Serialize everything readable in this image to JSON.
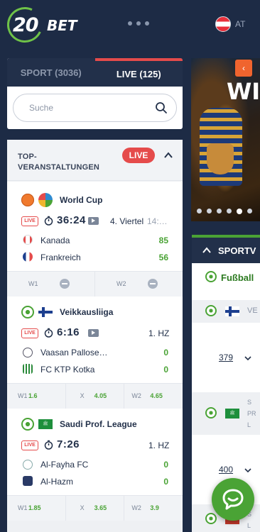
{
  "header": {
    "logo_number": "20",
    "logo_word": "BET",
    "language": "AT"
  },
  "tabs": {
    "sport": "SPORT (3036)",
    "live": "LIVE (125)"
  },
  "search": {
    "placeholder": "Suche"
  },
  "top_events": {
    "title_line1": "TOP-",
    "title_line2": "VERANSTALTUNGEN",
    "live_badge": "LIVE"
  },
  "events": [
    {
      "league": "World Cup",
      "live_tag": "LIVE",
      "time": "36:24",
      "period": "4. Viertel",
      "period_extra": "14:…",
      "team1": "Kanada",
      "team2": "Frankreich",
      "score1": "85",
      "score2": "56",
      "odds": [
        {
          "label": "W1",
          "value": ""
        },
        {
          "label": "W2",
          "value": ""
        }
      ]
    },
    {
      "league": "Veikkausliiga",
      "live_tag": "LIVE",
      "time": "6:16",
      "period": "1. HZ",
      "team1": "Vaasan Pallose…",
      "team2": "FC KTP Kotka",
      "score1": "0",
      "score2": "0",
      "odds": [
        {
          "label": "W1",
          "value": "1.6"
        },
        {
          "label": "X",
          "value": "4.05"
        },
        {
          "label": "W2",
          "value": "4.65"
        }
      ]
    },
    {
      "league": "Saudi Prof. League",
      "live_tag": "LIVE",
      "time": "7:26",
      "period": "1. HZ",
      "team1": "Al-Fayha FC",
      "team2": "Al-Hazm",
      "score1": "0",
      "score2": "0",
      "odds": [
        {
          "label": "W1",
          "value": "1.85"
        },
        {
          "label": "X",
          "value": "3.65"
        },
        {
          "label": "W2",
          "value": "3.9"
        }
      ]
    }
  ],
  "banner": {
    "text": "WI",
    "prev_arrow": "‹"
  },
  "sportsview": {
    "title": "SPORTV",
    "category": "Fußball",
    "row1_league": "VE",
    "row1_count": "379",
    "row2_league_lines": [
      "S",
      "PR",
      "L"
    ],
    "row2_count": "400",
    "row3_league_lines": [
      "S",
      "L"
    ]
  },
  "colors": {
    "accent_green": "#4aa335",
    "live_red": "#e54b4b",
    "header_navy": "#1d2b45"
  }
}
